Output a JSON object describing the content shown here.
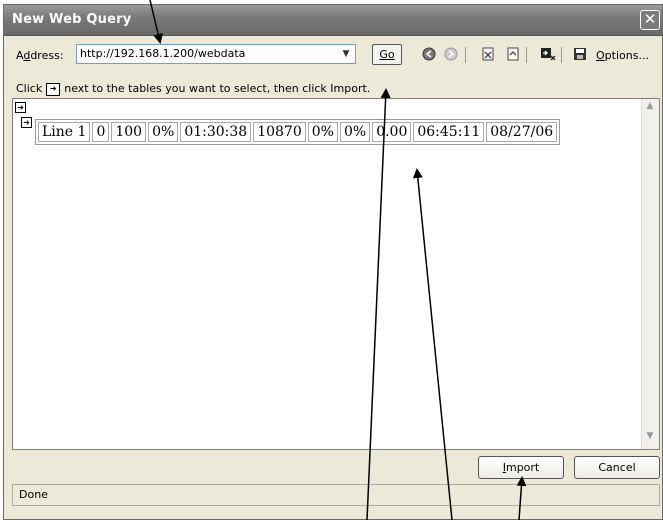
{
  "window": {
    "title": "New Web Query",
    "close_glyph": "✕"
  },
  "address_bar": {
    "label_pre": "A",
    "label_u": "d",
    "label_post": "dress:",
    "value": "http://192.168.1.200/webdata",
    "dropdown_icon": "chevron-down-icon"
  },
  "toolbar": {
    "go_label": "Go",
    "options_u": "O",
    "options_rest": "ptions...",
    "icons": [
      "back-icon",
      "forward-icon",
      "stop-icon",
      "refresh-icon",
      "hide-icons-icon",
      "save-query-icon"
    ]
  },
  "instruction": {
    "pre": "Click",
    "post": "next to the tables you want to select, then click Import."
  },
  "web_table": {
    "cells": [
      "Line 1",
      "0",
      "100",
      "0%",
      "01:30:38",
      "10870",
      "0%",
      "0%",
      "0.00",
      "06:45:11",
      "08/27/06"
    ]
  },
  "buttons": {
    "import_u": "I",
    "import_rest": "mport",
    "cancel": "Cancel"
  },
  "status": {
    "text": "Done"
  },
  "annotation_color": "#000000"
}
